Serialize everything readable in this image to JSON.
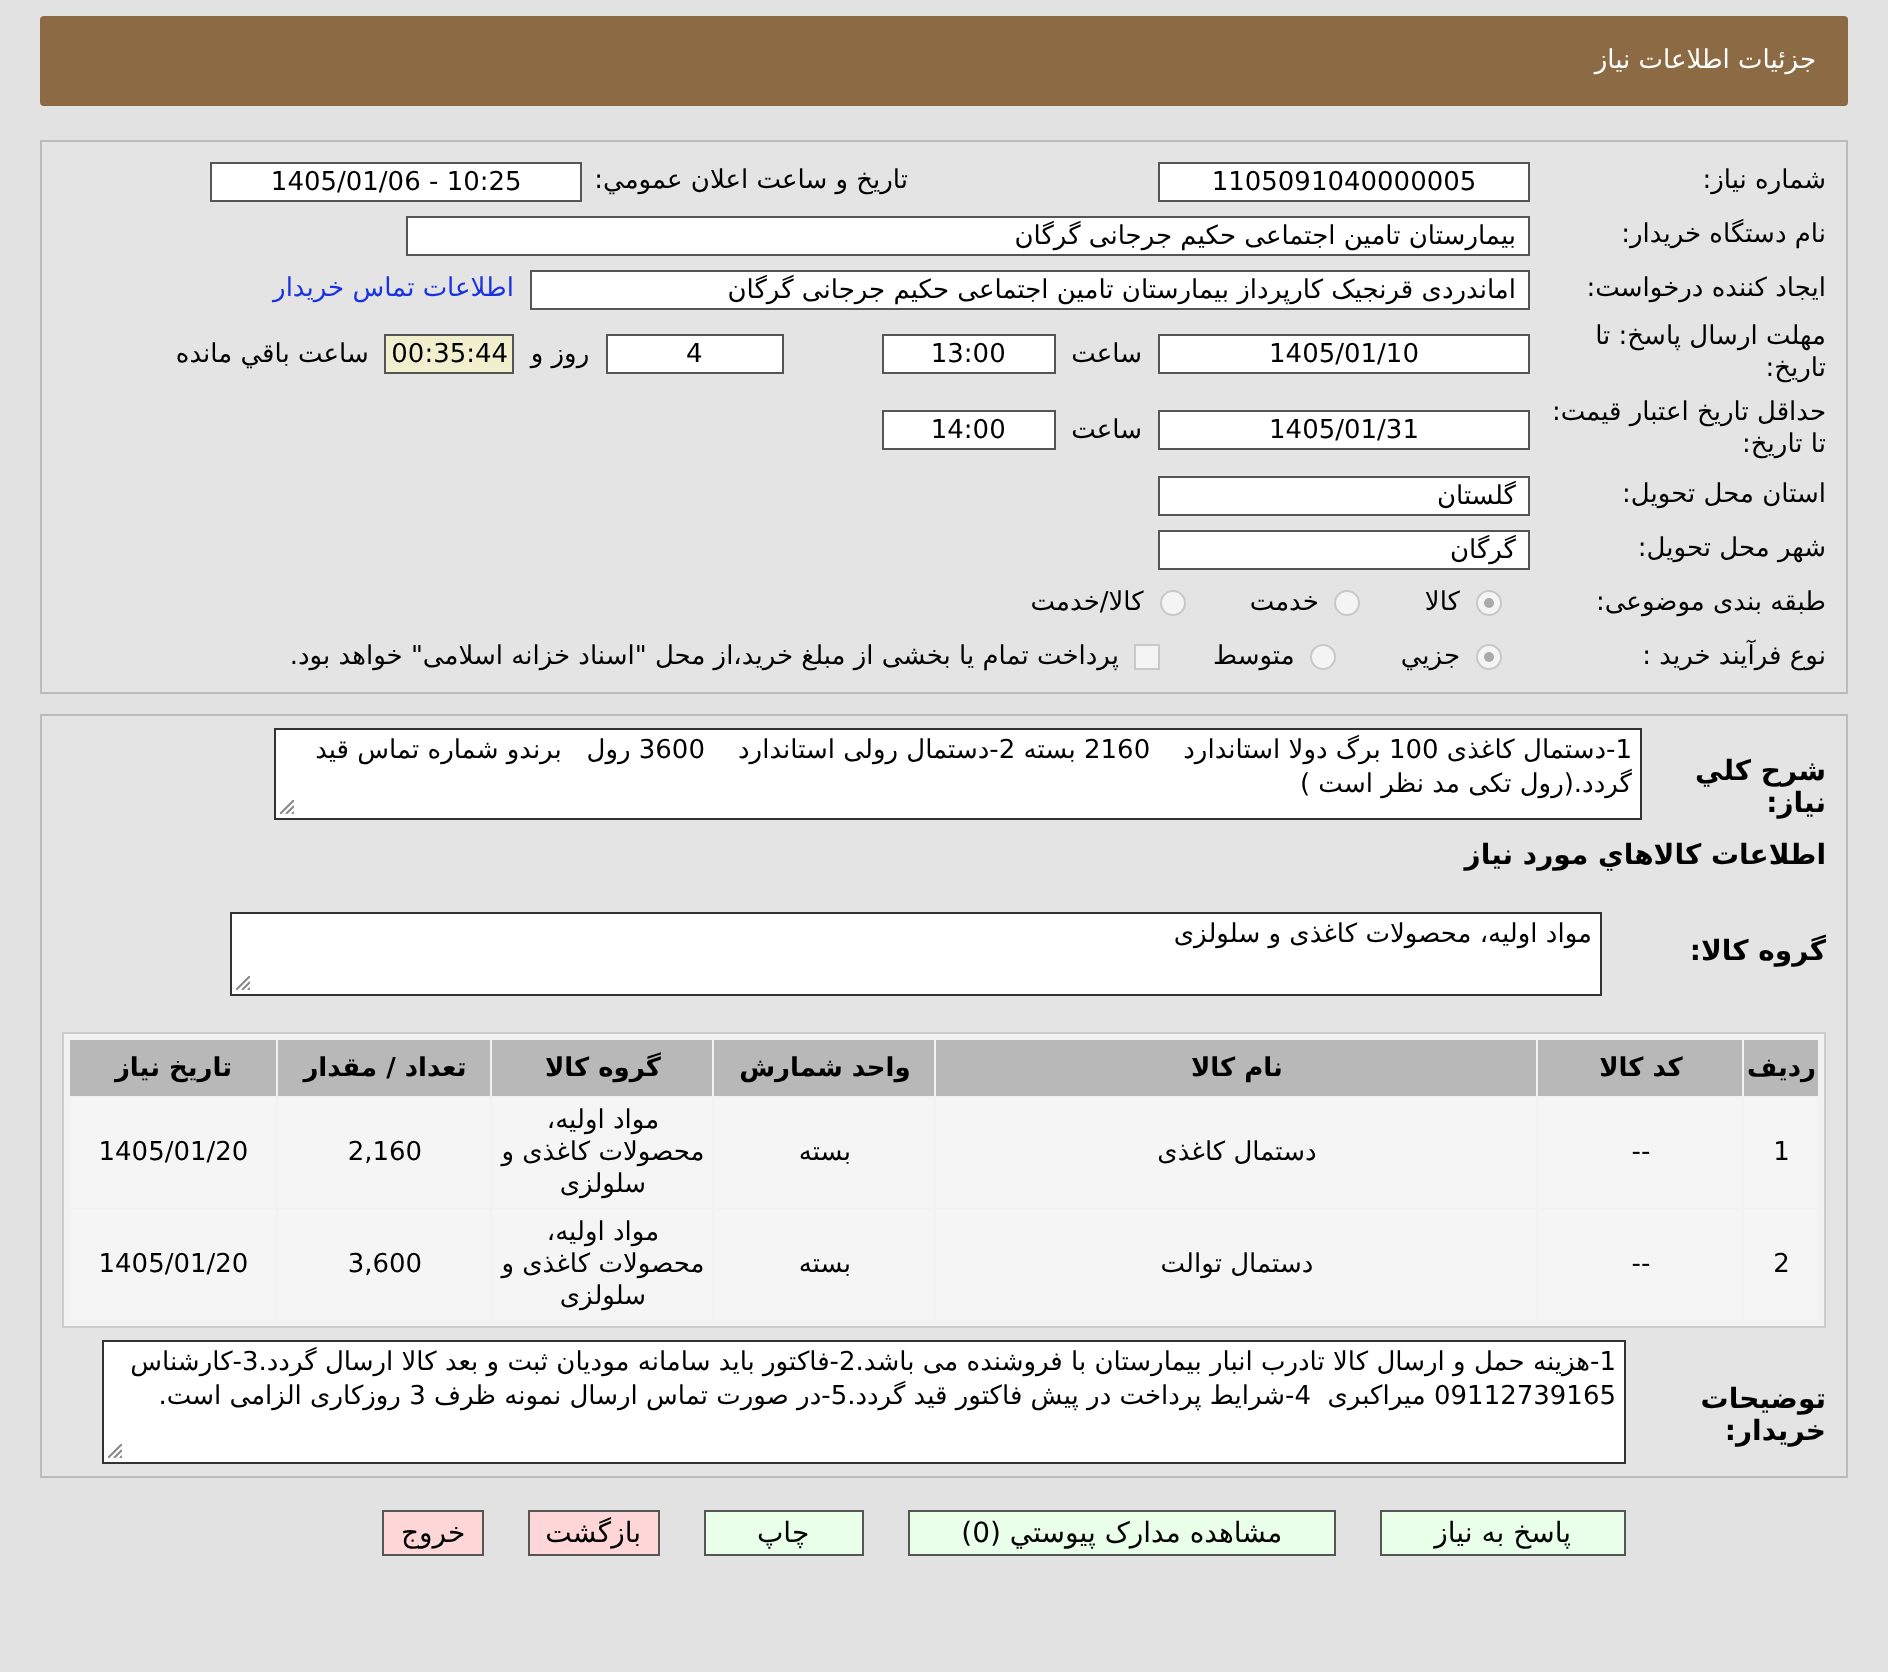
{
  "header": {
    "title": "جزئیات اطلاعات نیاز"
  },
  "details": {
    "need_number": {
      "label": "شماره نیاز:",
      "value": "1105091040000005"
    },
    "announce": {
      "label": "تاریخ و ساعت اعلان عمومي:",
      "value": "10:25 - 1405/01/06"
    },
    "buyer_org": {
      "label": "نام دستگاه خریدار:",
      "value": "بیمارستان تامین اجتماعی حکیم جرجانی گرگان"
    },
    "creator": {
      "label": "ایجاد کننده درخواست:",
      "value": "اماندردی قرنجیک کارپرداز بیمارستان تامین اجتماعی حکیم جرجانی گرگان",
      "link": "اطلاعات تماس خریدار"
    },
    "reply_deadline": {
      "label": "مهلت ارسال پاسخ: تا تاریخ:",
      "date": "1405/01/10",
      "time_label": "ساعت",
      "time": "13:00",
      "days": "4",
      "days_label": "روز و",
      "remaining": "00:35:44",
      "remaining_label": "ساعت باقي مانده"
    },
    "price_validity": {
      "label": "حداقل تاریخ اعتبار قیمت: تا تاریخ:",
      "date": "1405/01/31",
      "time_label": "ساعت",
      "time": "14:00"
    },
    "province": {
      "label": "استان محل تحویل:",
      "value": "گلستان"
    },
    "city": {
      "label": "شهر محل تحویل:",
      "value": "گرگان"
    },
    "category": {
      "label": "طبقه بندی موضوعی:",
      "options": [
        {
          "label": "کالا",
          "selected": true
        },
        {
          "label": "خدمت",
          "selected": false
        },
        {
          "label": "کالا/خدمت",
          "selected": false
        }
      ]
    },
    "process": {
      "label": "نوع فرآیند خرید :",
      "options": [
        {
          "label": "جزيي",
          "selected": true
        },
        {
          "label": "متوسط",
          "selected": false
        }
      ],
      "payment": {
        "label": "پرداخت تمام یا بخشی از مبلغ خرید،از محل \"اسناد خزانه اسلامی\" خواهد بود.",
        "checked": false
      }
    }
  },
  "requirements": {
    "summary": {
      "label": "شرح کلي نیاز:",
      "text": "1-دستمال کاغذی 100 برگ دولا استاندارد    2160 بسته 2-دستمال رولی استاندارد    3600 رول   برندو شماره تماس قید گردد.(رول تکی مد نظر است )"
    },
    "goods_heading": "اطلاعات کالاهاي مورد نیاز",
    "goods_group": {
      "label": "گروه کالا:",
      "text": "مواد اولیه، محصولات کاغذی و سلولزی"
    },
    "table": {
      "columns": [
        "ردیف",
        "کد کالا",
        "نام کالا",
        "واحد شمارش",
        "گروه کالا",
        "تعداد / مقدار",
        "تاریخ نیاز"
      ],
      "rows": [
        [
          "1",
          "--",
          "دستمال کاغذی",
          "بسته",
          "مواد اولیه، محصولات کاغذی و سلولزی",
          "2,160",
          "1405/01/20"
        ],
        [
          "2",
          "--",
          "دستمال توالت",
          "بسته",
          "مواد اولیه، محصولات کاغذی و سلولزی",
          "3,600",
          "1405/01/20"
        ]
      ]
    },
    "buyer_notes": {
      "label": "توضیحات خریدار:",
      "text": "1-هزینه حمل و ارسال کالا تادرب انبار بیمارستان با فروشنده می باشد.2-فاکتور باید سامانه مودیان ثبت و بعد کالا ارسال گردد.3-کارشناس 09112739165 میراکبری  4-شرایط پرداخت در پیش فاکتور قید گردد.5-در صورت تماس ارسال نمونه ظرف 3 روزکاری الزامی است."
    }
  },
  "buttons": [
    {
      "label": "پاسخ به نیاز",
      "kind": "action"
    },
    {
      "label": "مشاهده مدارک پیوستي (0)",
      "kind": "action"
    },
    {
      "label": "چاپ",
      "kind": "action"
    },
    {
      "label": "بازگشت",
      "kind": "exit"
    },
    {
      "label": "خروج",
      "kind": "exit"
    }
  ]
}
